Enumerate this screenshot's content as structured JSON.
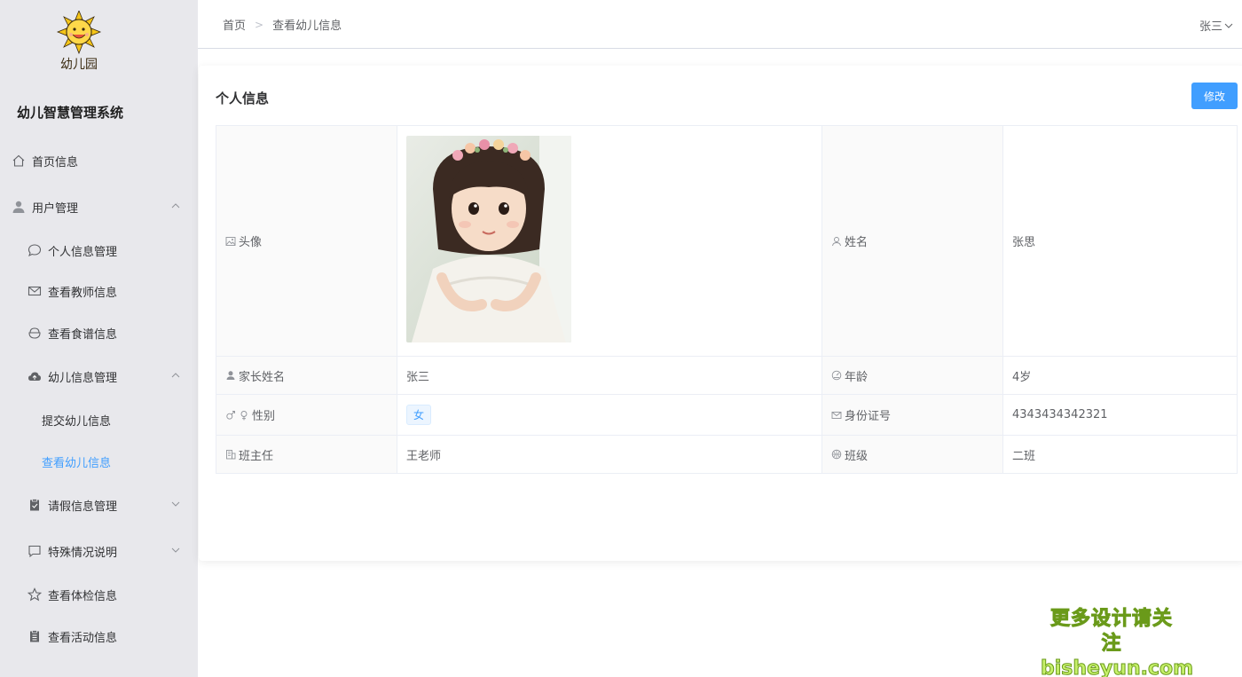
{
  "sidebar": {
    "logo_text": "幼儿园",
    "app_title": "幼儿智慧管理系统",
    "items": [
      {
        "label": "首页信息"
      },
      {
        "label": "用户管理"
      },
      {
        "label": "个人信息管理"
      },
      {
        "label": "查看教师信息"
      },
      {
        "label": "查看食谱信息"
      },
      {
        "label": "幼儿信息管理"
      },
      {
        "label": "提交幼儿信息"
      },
      {
        "label": "查看幼儿信息"
      },
      {
        "label": "请假信息管理"
      },
      {
        "label": "特殊情况说明"
      },
      {
        "label": "查看体检信息"
      },
      {
        "label": "查看活动信息"
      }
    ]
  },
  "header": {
    "breadcrumb": [
      "首页",
      "查看幼儿信息"
    ],
    "user_name": "张三"
  },
  "card": {
    "title": "个人信息",
    "edit_label": "修改",
    "rows": {
      "avatar_label": "头像",
      "name_label": "姓名",
      "name_value": "张思",
      "parent_label": "家长姓名",
      "parent_value": "张三",
      "age_label": "年龄",
      "age_value": "4岁",
      "gender_label": "性别",
      "gender_value": "女",
      "id_label": "身份证号",
      "id_value": "4343434342321",
      "teacher_label": "班主任",
      "teacher_value": "王老师",
      "class_label": "班级",
      "class_value": "二班"
    }
  },
  "watermark": {
    "line1": "更多设计请关注",
    "line2": "bisheyun.com"
  },
  "colors": {
    "accent": "#409eff",
    "sidebar_bg": "#e8e8ec"
  }
}
